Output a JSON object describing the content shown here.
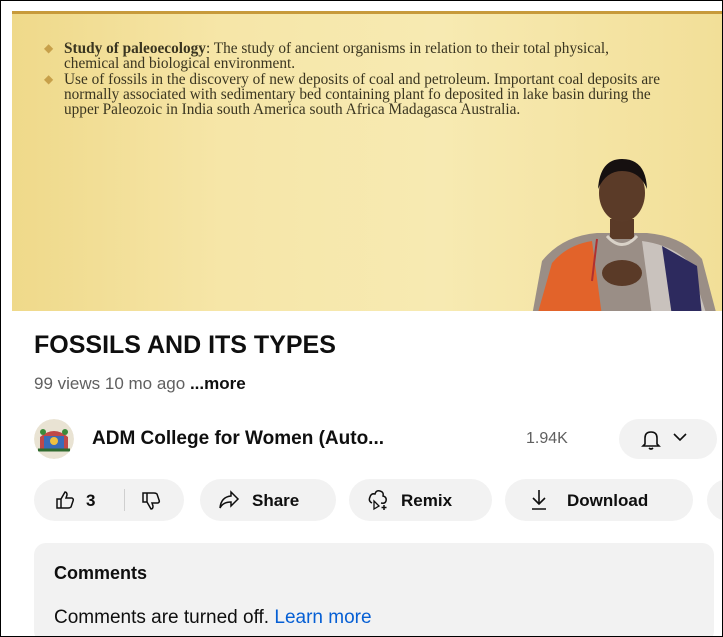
{
  "video": {
    "slide": {
      "bullet1_bold": "Study of paleoecology",
      "bullet1_text": ": The study of ancient organisms in relation to their total physical, chemical and biological environment.",
      "bullet2_text": "Use of fossils in the discovery of new deposits of coal and petroleum. Important coal deposits are normally associated with sedimentary bed containing plant fo deposited in lake basin during the upper Paleozoic in India south America south Africa Madagasca Australia."
    },
    "progress_fraction": 0.99,
    "progress_color": "#ff0033"
  },
  "info": {
    "title": "FOSSILS AND ITS TYPES",
    "views": "99 views",
    "age": "10 mo ago",
    "more": "...more"
  },
  "channel": {
    "name": "ADM College for Women (Auto...",
    "subscribers": "1.94K",
    "bell_icon": "bell-icon",
    "chevron_icon": "chevron-down-icon"
  },
  "actions": {
    "like_count": "3",
    "share_label": "Share",
    "remix_label": "Remix",
    "download_label": "Download"
  },
  "comments": {
    "heading": "Comments",
    "message": "Comments are turned off.",
    "link": "Learn more"
  },
  "colors": {
    "link": "#065fd4",
    "chip_bg": "#f2f2f2",
    "text": "#0f0f0f",
    "secondary": "#606060"
  }
}
